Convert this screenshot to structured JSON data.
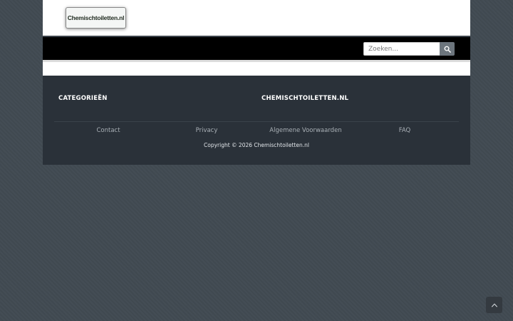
{
  "header": {
    "logo_text": "Chemischtoiletten.nl"
  },
  "navbar": {
    "search": {
      "placeholder": "Zoeken...",
      "value": ""
    }
  },
  "footer": {
    "col1_title": "CATEGORIEËN",
    "col2_title": "CHEMISCHTOILETTEN.NL",
    "links": [
      {
        "label": "Contact"
      },
      {
        "label": "Privacy"
      },
      {
        "label": "Algemene Voorwaarden"
      },
      {
        "label": "FAQ"
      }
    ],
    "copyright": "Copyright © 2026 Chemischtoiletten.nl"
  },
  "icons": {
    "search": "search-icon",
    "back_to_top": "chevron-up-icon"
  },
  "colors": {
    "navbar": "#000000",
    "footer": "#2a3139",
    "background": "#414a52",
    "search_button": "#6c757d"
  }
}
